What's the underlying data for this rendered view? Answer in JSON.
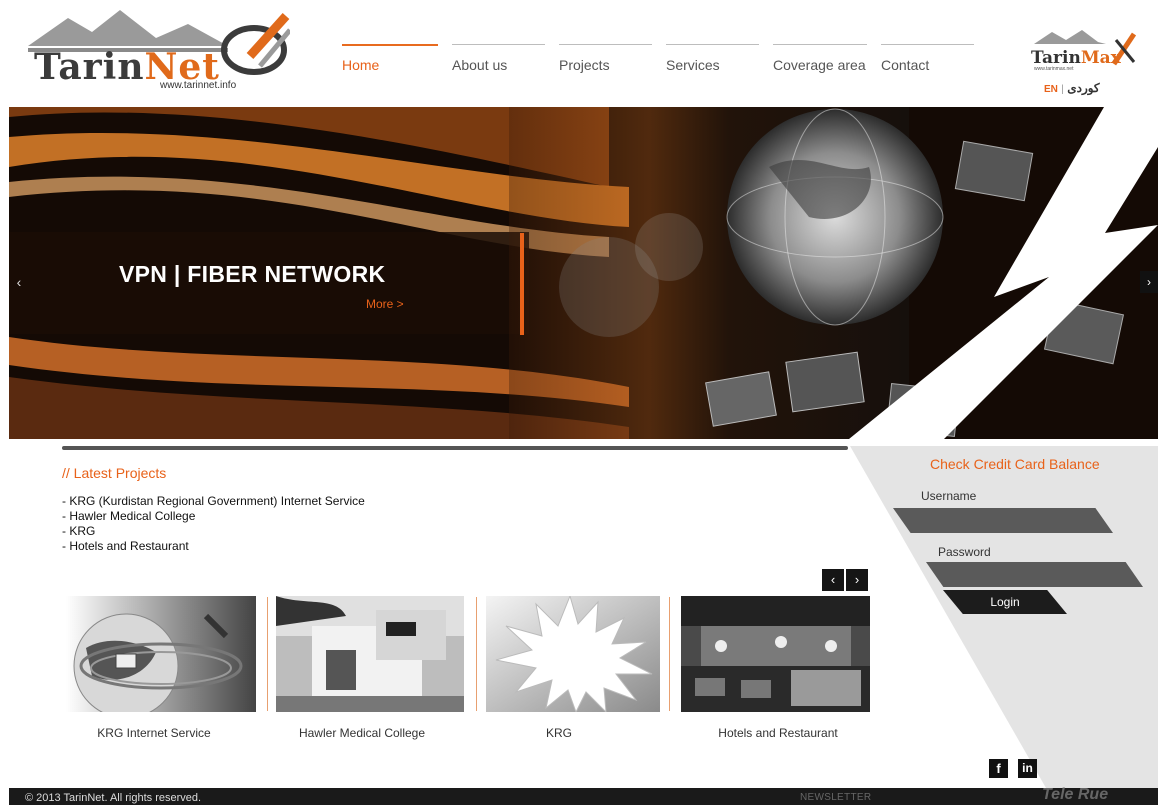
{
  "header": {
    "logo": {
      "brand_a": "Tarin",
      "brand_b": "Net",
      "url": "www.tarinnet.info"
    },
    "nav": [
      {
        "label": "Home",
        "active": true
      },
      {
        "label": "About us",
        "active": false
      },
      {
        "label": "Projects",
        "active": false
      },
      {
        "label": "Services",
        "active": false
      },
      {
        "label": "Coverage area",
        "active": false
      },
      {
        "label": "Contact",
        "active": false
      }
    ],
    "partner_logo": {
      "brand_a": "Tarin",
      "brand_b": "Max",
      "url": "www.tarinmax.net"
    },
    "language": {
      "en": "EN",
      "separator": "|",
      "ku": "كوردی"
    }
  },
  "hero": {
    "title": "VPN | FIBER NETWORK",
    "more": "More >",
    "prev_icon": "chevron-left-icon",
    "next_icon": "chevron-right-icon"
  },
  "latest_projects": {
    "title": "// Latest Projects",
    "items": [
      "- KRG (Kurdistan Regional Government) Internet Service",
      "- Hawler Medical College",
      "- KRG",
      "- Hotels and Restaurant"
    ],
    "carousel": [
      {
        "caption": "KRG Internet Service"
      },
      {
        "caption": "Hawler Medical College"
      },
      {
        "caption": "KRG"
      },
      {
        "caption": "Hotels and Restaurant"
      }
    ]
  },
  "balance": {
    "title": "Check Credit Card Balance",
    "username_label": "Username",
    "password_label": "Password",
    "login_label": "Login"
  },
  "social": {
    "facebook": "f",
    "linkedin": "in"
  },
  "footer": {
    "copyright": "© 2013 TarinNet. All rights reserved.",
    "newsletter": "NEWSLETTER",
    "partner": "Tele Rue"
  },
  "colors": {
    "accent": "#e8621a",
    "dark": "#1a1a1a",
    "panel": "#e6e6e6"
  }
}
